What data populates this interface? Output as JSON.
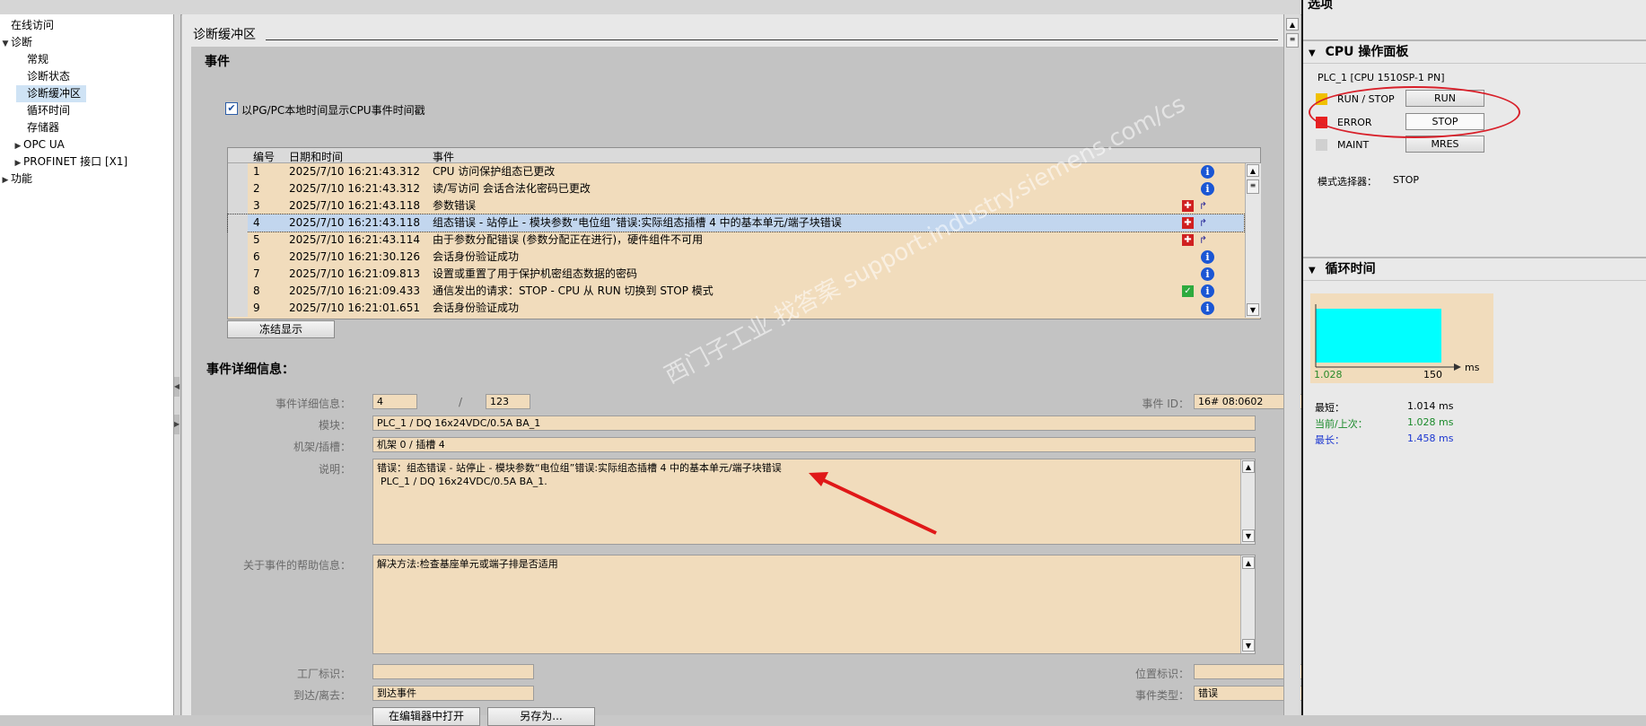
{
  "tree": {
    "items": [
      {
        "label": "在线访问",
        "level": 0,
        "arrow": ""
      },
      {
        "label": "诊断",
        "level": 0,
        "arrow": "▼"
      },
      {
        "label": "常规",
        "level": 1,
        "arrow": ""
      },
      {
        "label": "诊断状态",
        "level": 1,
        "arrow": ""
      },
      {
        "label": "诊断缓冲区",
        "level": 1,
        "arrow": "",
        "selected": true
      },
      {
        "label": "循环时间",
        "level": 1,
        "arrow": ""
      },
      {
        "label": "存储器",
        "level": 1,
        "arrow": ""
      },
      {
        "label": "OPC UA",
        "level": 1,
        "arrow": "▶"
      },
      {
        "label": "PROFINET 接口 [X1]",
        "level": 1,
        "arrow": "▶"
      },
      {
        "label": "功能",
        "level": 0,
        "arrow": "▶"
      }
    ]
  },
  "main": {
    "title": "诊断缓冲区",
    "events_section": "事件",
    "local_time_checkbox": "以PG/PC本地时间显示CPU事件时间戳",
    "columns": [
      "编号",
      "日期和时间",
      "事件"
    ],
    "rows": [
      {
        "no": "1",
        "dt": "2025/7/10 16:21:43.312",
        "ev": "CPU 访问保护组态已更改",
        "icon": "info"
      },
      {
        "no": "2",
        "dt": "2025/7/10 16:21:43.312",
        "ev": "读/写访问 会话合法化密码已更改",
        "icon": "info"
      },
      {
        "no": "3",
        "dt": "2025/7/10 16:21:43.118",
        "ev": "参数错误",
        "icon": "error"
      },
      {
        "no": "4",
        "dt": "2025/7/10 16:21:43.118",
        "ev": "组态错误 - 站停止 - 模块参数“电位组”错误:实际组态插槽 4 中的基本单元/端子块错误",
        "icon": "error",
        "selected": true
      },
      {
        "no": "5",
        "dt": "2025/7/10 16:21:43.114",
        "ev": "由于参数分配错误 (参数分配正在进行)，硬件组件不可用",
        "icon": "error"
      },
      {
        "no": "6",
        "dt": "2025/7/10 16:21:30.126",
        "ev": "会话身份验证成功",
        "icon": "info"
      },
      {
        "no": "7",
        "dt": "2025/7/10 16:21:09.813",
        "ev": "设置或重置了用于保护机密组态数据的密码",
        "icon": "info"
      },
      {
        "no": "8",
        "dt": "2025/7/10 16:21:09.433",
        "ev": "通信发出的请求：STOP - CPU 从 RUN 切换到 STOP 模式",
        "icon": "ok-info"
      },
      {
        "no": "9",
        "dt": "2025/7/10 16:21:01.651",
        "ev": "会话身份验证成功",
        "icon": "info"
      }
    ],
    "freeze_button": "冻结显示",
    "details_title": "事件详细信息：",
    "detail_label": "事件详细信息：",
    "detail_value": "4",
    "detail_sep": "/",
    "detail_total": "123",
    "event_id_label": "事件 ID：",
    "event_id_value": "16# 08:0602",
    "module_label": "模块：",
    "module_value": "PLC_1 / DQ 16x24VDC/0.5A BA_1",
    "rack_label": "机架/插槽：",
    "rack_value": "机架 0 / 插槽 4",
    "desc_label": "说明：",
    "desc_line1": "错误：组态错误 - 站停止 - 模块参数“电位组”错误:实际组态插槽 4 中的基本单元/端子块错误",
    "desc_line2": "PLC_1 / DQ 16x24VDC/0.5A BA_1.",
    "help_label": "关于事件的帮助信息：",
    "help_value": "解决方法:检查基座单元或端子排是否适用",
    "plant_label": "工厂标识：",
    "plant_value": "",
    "location_label": "位置标识：",
    "location_value": "",
    "coming_label": "到达/离去：",
    "coming_value": "到达事件",
    "type_label": "事件类型：",
    "type_value": "错误",
    "open_editor_button": "在编辑器中打开",
    "save_as_button": "另存为..."
  },
  "watermark": "西门子工业 找答案 support.industry.siemens.com/cs",
  "right": {
    "options_title": "选项",
    "cpu_panel_title": "CPU 操作面板",
    "plc_name": "PLC_1 [CPU 1510SP-1 PN]",
    "leds": [
      {
        "label": "RUN / STOP",
        "color": "#f0c000",
        "button": "RUN"
      },
      {
        "label": "ERROR",
        "color": "#e82020",
        "button": "STOP"
      },
      {
        "label": "MAINT",
        "color": "#d0d0d0",
        "button": "MRES"
      }
    ],
    "mode_label": "模式选择器：",
    "mode_value": "STOP",
    "cycle_title": "循环时间",
    "chart_min": "1.028",
    "chart_max": "150",
    "chart_unit": "ms",
    "stats": [
      {
        "label": "最短：",
        "value": "1.014 ms",
        "color": "#303030"
      },
      {
        "label": "当前/上次：",
        "value": "1.028 ms",
        "color": "#1a8a2a"
      },
      {
        "label": "最长：",
        "value": "1.458 ms",
        "color": "#1a35d0"
      }
    ]
  },
  "chart_data": {
    "type": "bar",
    "categories": [
      "当前/上次"
    ],
    "values": [
      1.028
    ],
    "xlabel": "ms",
    "xlim": [
      1.028,
      150
    ]
  }
}
